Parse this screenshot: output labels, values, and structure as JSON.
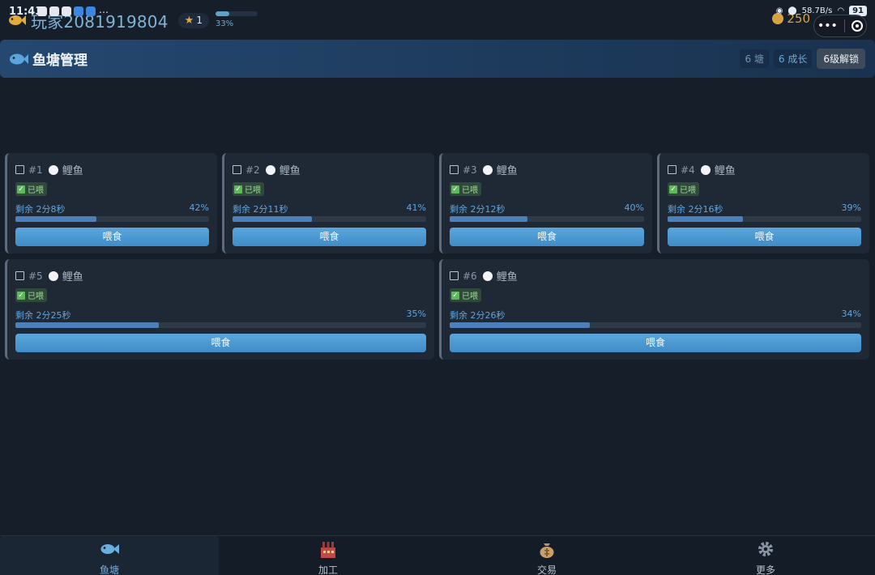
{
  "status_bar": {
    "time": "11:43",
    "more": "…",
    "net_speed": "58.7B/s",
    "battery": "91"
  },
  "player": {
    "name": "玩家2081919804",
    "level": "1",
    "xp_percent_text": "33%",
    "xp_fraction": 0.33,
    "coins": "250"
  },
  "capsule": {
    "more": "•••"
  },
  "title_bar": {
    "title": "鱼塘管理",
    "ponds_tag": "6 塘",
    "growing_tag": "6 成长",
    "unlock_button": "6级解锁"
  },
  "ponds": [
    {
      "num": "#1",
      "fish": "鲤鱼",
      "fed": "已喂",
      "remain": "剩余 2分8秒",
      "pct_text": "42%",
      "progress": 0.42,
      "feed": "喂食"
    },
    {
      "num": "#2",
      "fish": "鲤鱼",
      "fed": "已喂",
      "remain": "剩余 2分11秒",
      "pct_text": "41%",
      "progress": 0.41,
      "feed": "喂食"
    },
    {
      "num": "#3",
      "fish": "鲤鱼",
      "fed": "已喂",
      "remain": "剩余 2分12秒",
      "pct_text": "40%",
      "progress": 0.4,
      "feed": "喂食"
    },
    {
      "num": "#4",
      "fish": "鲤鱼",
      "fed": "已喂",
      "remain": "剩余 2分16秒",
      "pct_text": "39%",
      "progress": 0.39,
      "feed": "喂食"
    },
    {
      "num": "#5",
      "fish": "鲤鱼",
      "fed": "已喂",
      "remain": "剩余 2分25秒",
      "pct_text": "35%",
      "progress": 0.35,
      "feed": "喂食"
    },
    {
      "num": "#6",
      "fish": "鲤鱼",
      "fed": "已喂",
      "remain": "剩余 2分26秒",
      "pct_text": "34%",
      "progress": 0.34,
      "feed": "喂食"
    }
  ],
  "nav": [
    {
      "label": "鱼塘",
      "icon": "fish-icon",
      "active": true
    },
    {
      "label": "加工",
      "icon": "factory-icon",
      "active": false
    },
    {
      "label": "交易",
      "icon": "money-bag-icon",
      "active": false
    },
    {
      "label": "更多",
      "icon": "gear-icon",
      "active": false
    }
  ],
  "colors": {
    "accent": "#5aa6dc",
    "background": "#161e29",
    "card": "#1f2935",
    "fed_green": "#5fb85c",
    "coin": "#d9a240"
  }
}
